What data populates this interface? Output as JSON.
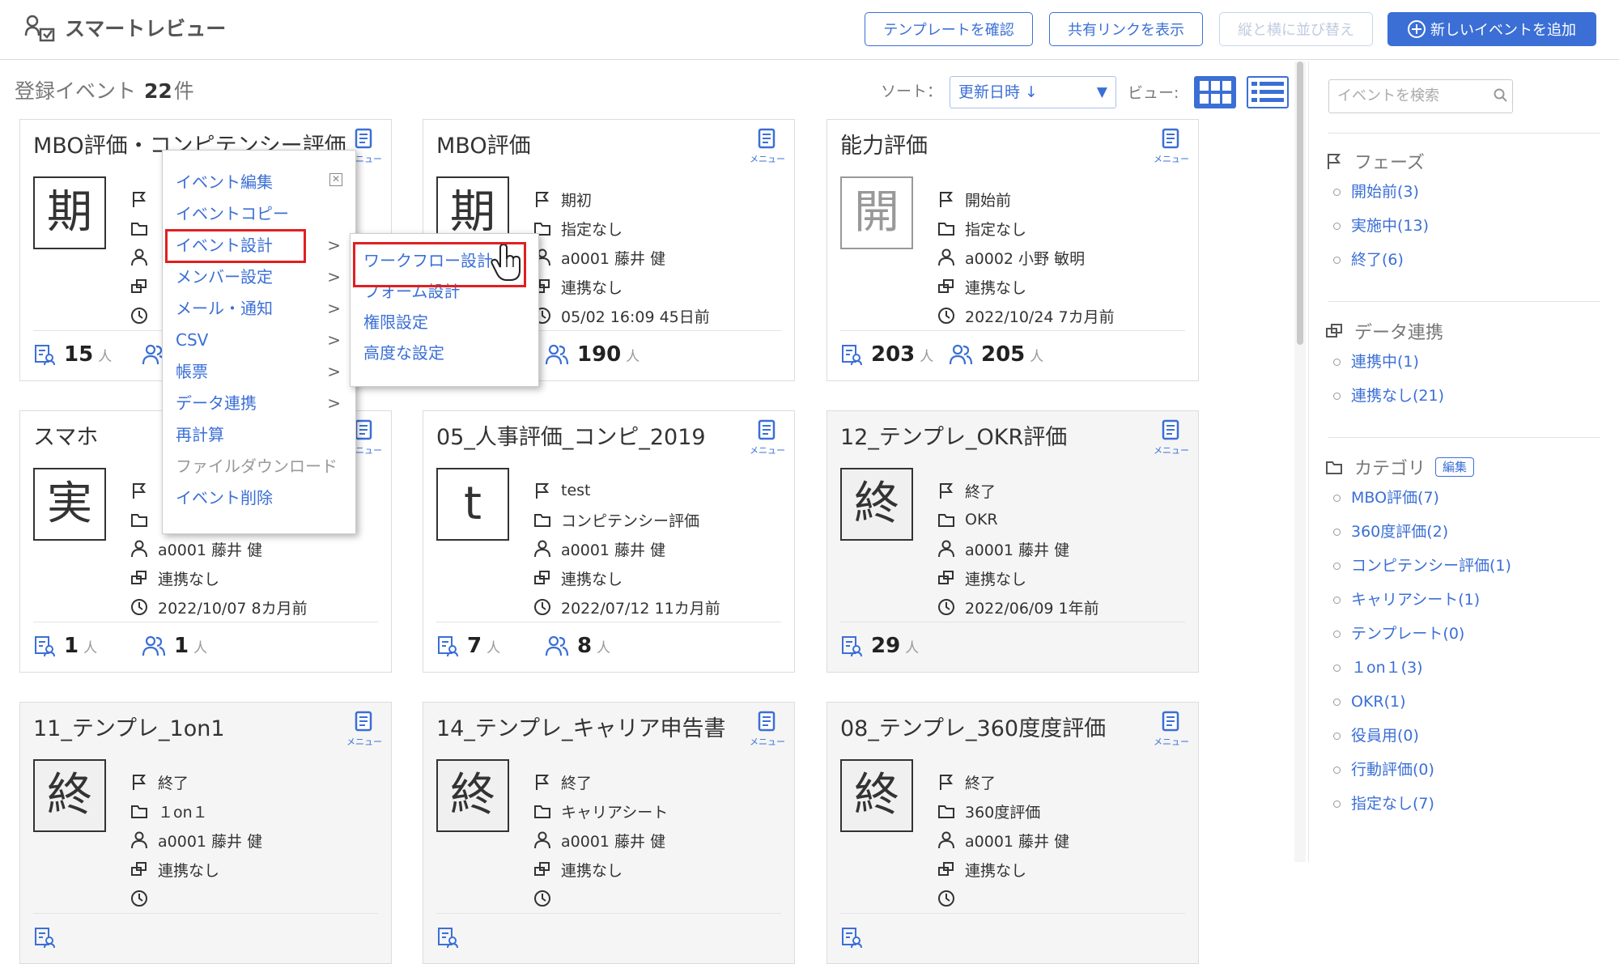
{
  "app": {
    "title": "スマートレビュー",
    "icon": "users-icon"
  },
  "header": {
    "buttons": [
      {
        "label": "テンプレートを確認",
        "state": "enabled"
      },
      {
        "label": "共有リンクを表示",
        "state": "enabled"
      },
      {
        "label": "縦と横に並び替え",
        "state": "disabled"
      },
      {
        "label": "新しいイベントを追加",
        "state": "primary"
      }
    ]
  },
  "toolbar": {
    "count_prefix": "登録イベント",
    "count_value": "22",
    "count_suffix": "件",
    "sort_label": "ソート：",
    "sort_value": "更新日時 ↓",
    "view_label": "ビュー:"
  },
  "search": {
    "placeholder": "イベントを検索"
  },
  "sidebar": {
    "phase": {
      "title": "フェーズ",
      "items": [
        "開始前(3)",
        "実施中(13)",
        "終了(6)"
      ]
    },
    "integration": {
      "title": "データ連携",
      "items": [
        "連携中(1)",
        "連携なし(21)"
      ]
    },
    "category": {
      "title": "カテゴリ",
      "edit_label": "編集",
      "items": [
        "MBO評価(7)",
        "360度評価(2)",
        "コンピテンシー評価(1)",
        "キャリアシート(1)",
        "テンプレート(0)",
        "１on１(3)",
        "OKR(1)",
        "役員用(0)",
        "行動評価(0)",
        "指定なし(7)"
      ]
    }
  },
  "menu_icon_label": "メニュー",
  "cards": [
    {
      "title": "MBO評価・コンピテンシー評価",
      "phase_char": "期",
      "phase": "",
      "category": "",
      "owner": "",
      "integration": "",
      "updated": "",
      "stat1": "15",
      "stat2": "",
      "unit": "人",
      "ended": false
    },
    {
      "title": "MBO評価",
      "phase_char": "期",
      "phase": "期初",
      "category": "指定なし",
      "owner": "a0001 藤井 健",
      "integration": "連携なし",
      "updated": "05/02 16:09 45日前",
      "stat1": "",
      "stat2": "190",
      "unit": "人",
      "ended": false
    },
    {
      "title": "能力評価",
      "phase_char": "開",
      "phase": "開始前",
      "category": "指定なし",
      "owner": "a0002 小野 敏明",
      "integration": "連携なし",
      "updated": "2022/10/24 7カ月前",
      "stat1": "203",
      "stat2": "205",
      "unit": "人",
      "ended": false
    },
    {
      "title": "スマホ",
      "phase_char": "実",
      "phase": "",
      "category": "",
      "owner": "a0001 藤井 健",
      "integration": "連携なし",
      "updated": "2022/10/07 8カ月前",
      "stat1": "1",
      "stat2": "1",
      "unit": "人",
      "ended": false
    },
    {
      "title": "05_人事評価_コンピ_2019",
      "phase_char": "t",
      "phase": "test",
      "category": "コンピテンシー評価",
      "owner": "a0001 藤井 健",
      "integration": "連携なし",
      "updated": "2022/07/12 11カ月前",
      "stat1": "7",
      "stat2": "8",
      "unit": "人",
      "ended": false
    },
    {
      "title": "12_テンプレ_OKR評価",
      "phase_char": "終",
      "phase": "終了",
      "category": "OKR",
      "owner": "a0001 藤井 健",
      "integration": "連携なし",
      "updated": "2022/06/09 1年前",
      "stat1": "29",
      "stat2": "",
      "unit": "人",
      "ended": true
    },
    {
      "title": "11_テンプレ_1on1",
      "phase_char": "終",
      "phase": "終了",
      "category": "１on１",
      "owner": "a0001 藤井 健",
      "integration": "連携なし",
      "updated": "",
      "stat1": "",
      "stat2": "",
      "unit": "人",
      "ended": true
    },
    {
      "title": "14_テンプレ_キャリア申告書",
      "phase_char": "終",
      "phase": "終了",
      "category": "キャリアシート",
      "owner": "a0001 藤井 健",
      "integration": "連携なし",
      "updated": "",
      "stat1": "",
      "stat2": "",
      "unit": "人",
      "ended": true
    },
    {
      "title": "08_テンプレ_360度度評価",
      "phase_char": "終",
      "phase": "終了",
      "category": "360度評価",
      "owner": "a0001 藤井 健",
      "integration": "連携なし",
      "updated": "",
      "stat1": "",
      "stat2": "",
      "unit": "人",
      "ended": true
    }
  ],
  "context_menu": {
    "items": [
      {
        "label": "イベント編集",
        "submenu": false,
        "disabled": false
      },
      {
        "label": "イベントコピー",
        "submenu": false,
        "disabled": false
      },
      {
        "label": "イベント設計",
        "submenu": true,
        "disabled": false
      },
      {
        "label": "メンバー設定",
        "submenu": true,
        "disabled": false
      },
      {
        "label": "メール・通知",
        "submenu": true,
        "disabled": false
      },
      {
        "label": "CSV",
        "submenu": true,
        "disabled": false
      },
      {
        "label": "帳票",
        "submenu": true,
        "disabled": false
      },
      {
        "label": "データ連携",
        "submenu": true,
        "disabled": false
      },
      {
        "label": "再計算",
        "submenu": false,
        "disabled": false
      },
      {
        "label": "ファイルダウンロード",
        "submenu": false,
        "disabled": true
      },
      {
        "label": "イベント削除",
        "submenu": false,
        "disabled": false
      }
    ],
    "submenu_items": [
      "ワークフロー設計",
      "フォーム設計",
      "権限設定",
      "高度な設定"
    ]
  },
  "colors": {
    "accent": "#3b6fd6",
    "highlight": "#e02020"
  }
}
